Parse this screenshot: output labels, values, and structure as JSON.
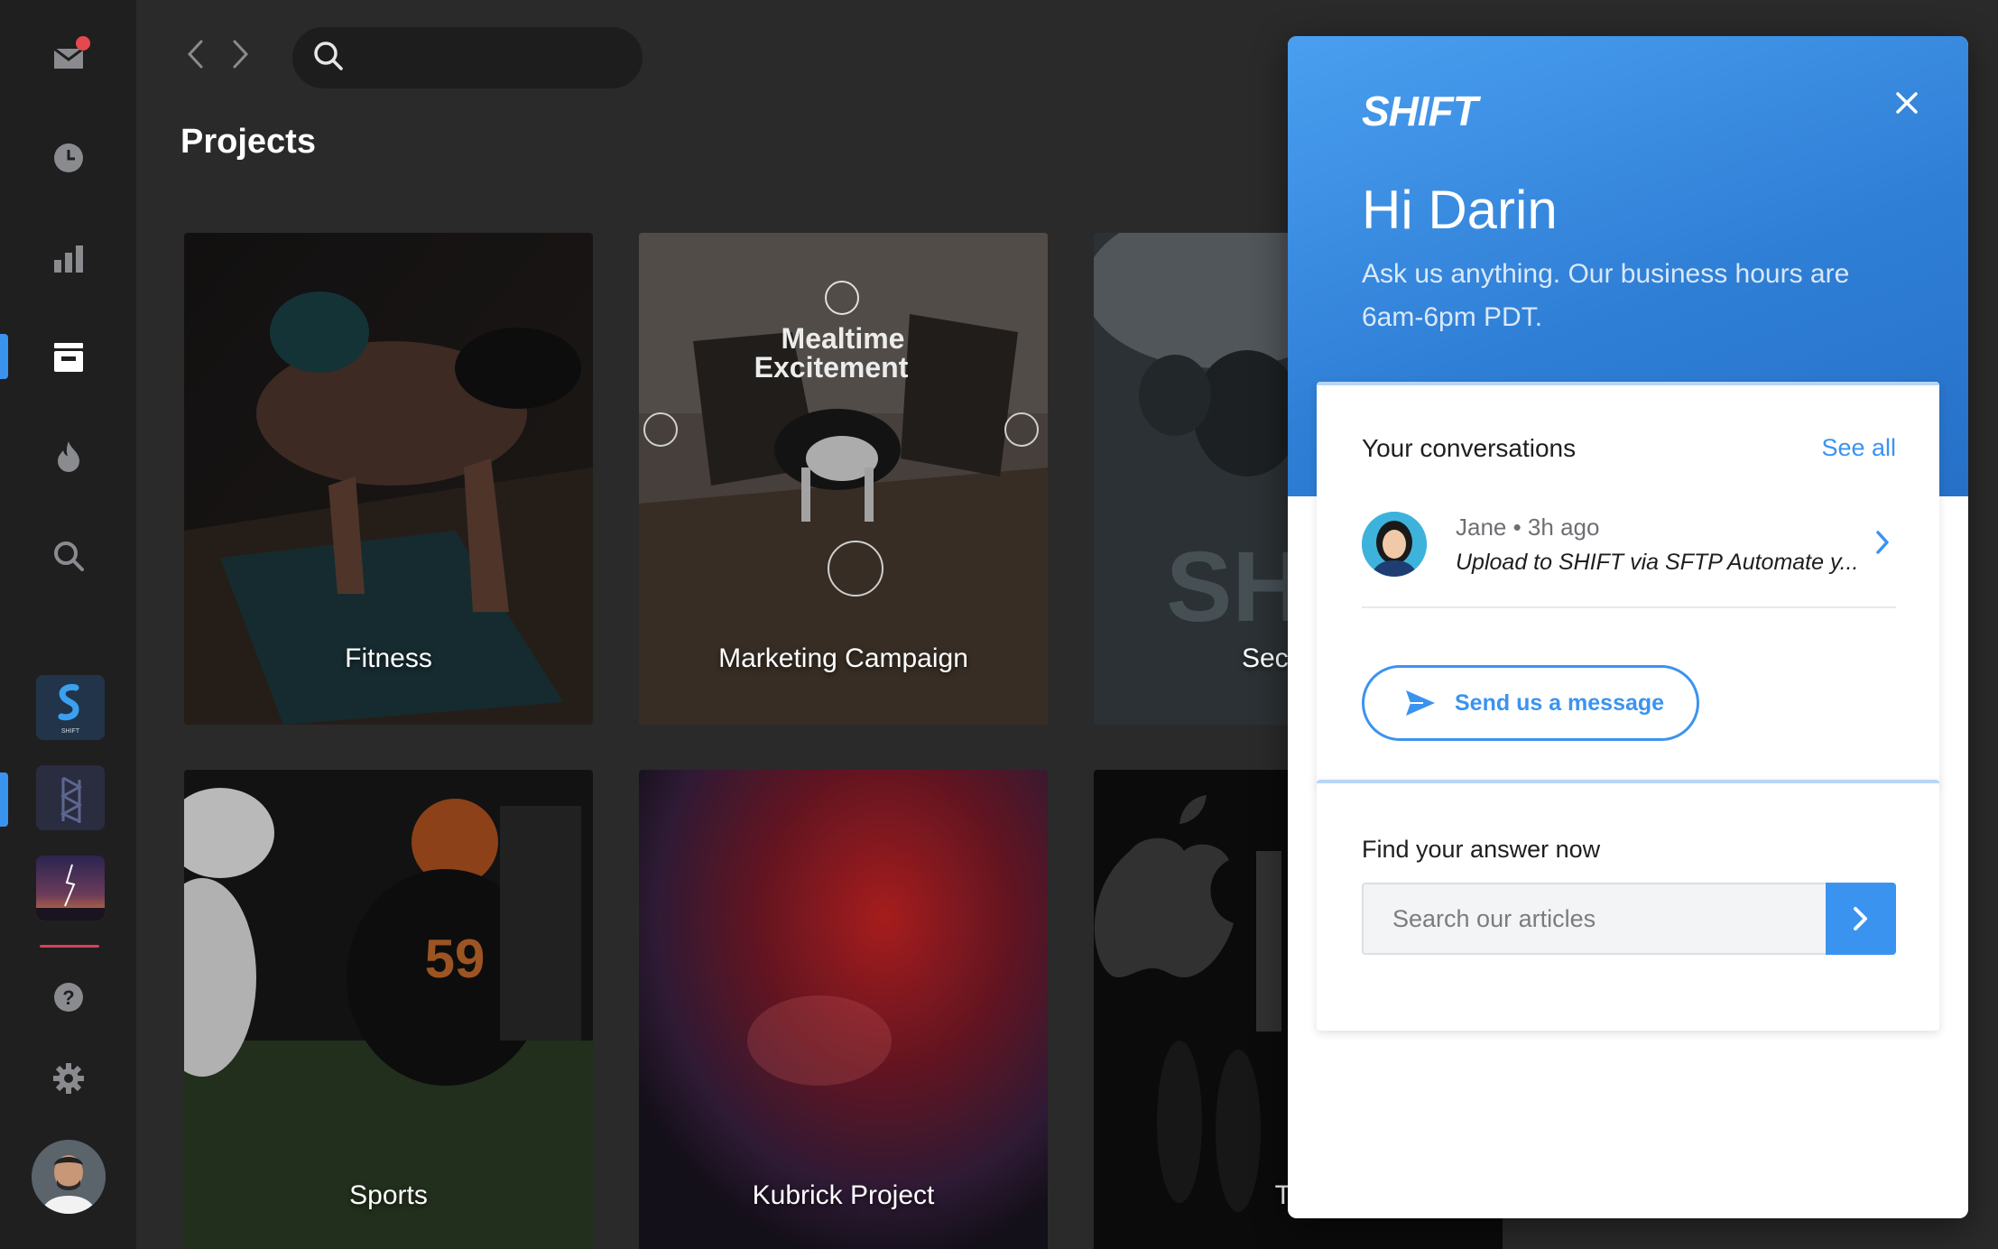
{
  "header": {
    "search_placeholder": "",
    "page_title": "Projects"
  },
  "rail": {
    "items": [
      {
        "name": "inbox",
        "icon": "mail-icon"
      },
      {
        "name": "recent",
        "icon": "clock-icon"
      },
      {
        "name": "analytics",
        "icon": "bar-chart-icon"
      },
      {
        "name": "projects",
        "icon": "archive-icon",
        "active": true
      },
      {
        "name": "trending",
        "icon": "flame-icon"
      },
      {
        "name": "search",
        "icon": "search-icon"
      },
      {
        "name": "help",
        "icon": "help-icon"
      },
      {
        "name": "settings",
        "icon": "gear-icon"
      }
    ],
    "workspaces": [
      {
        "name": "shift",
        "logo_text": "SHIFT"
      },
      {
        "name": "workspace-2"
      },
      {
        "name": "workspace-3"
      }
    ]
  },
  "projects": [
    {
      "title": "Fitness"
    },
    {
      "title": "Marketing Campaign"
    },
    {
      "title": "Secure w"
    },
    {
      "title": "Sports"
    },
    {
      "title": "Kubrick Project"
    },
    {
      "title": "The"
    }
  ],
  "widget": {
    "brand": "SHIFT",
    "greeting": "Hi Darin",
    "hours_text": "Ask us anything. Our business hours are 6am-6pm PDT.",
    "conversations": {
      "title": "Your conversations",
      "see_all": "See all",
      "items": [
        {
          "author": "Jane",
          "time": "3h ago",
          "meta": "Jane • 3h ago",
          "snippet": "Upload to SHIFT via SFTP Automate y..."
        }
      ],
      "send_label": "Send us a message"
    },
    "help": {
      "title": "Find your answer now",
      "search_placeholder": "Search our articles"
    }
  },
  "colors": {
    "accent": "#3b93f0",
    "background": "#2a2a2b",
    "rail": "#1f1f20",
    "notification": "#e5484d"
  }
}
